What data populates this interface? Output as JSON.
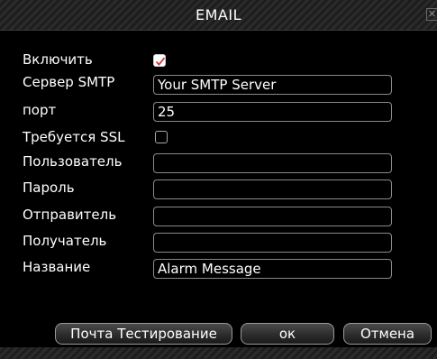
{
  "window": {
    "title": "EMAIL",
    "close_icon": "close-icon"
  },
  "form": {
    "enable": {
      "label": "Включить",
      "checked": true
    },
    "smtp_server": {
      "label": "Сервер SMTP",
      "value": "Your SMTP Server"
    },
    "port": {
      "label": "порт",
      "value": "25"
    },
    "ssl": {
      "label": "Требуется SSL",
      "checked": false
    },
    "user": {
      "label": "Пользователь",
      "value": ""
    },
    "password": {
      "label": "Пароль",
      "value": ""
    },
    "sender": {
      "label": "Отправитель",
      "value": ""
    },
    "receiver": {
      "label": "Получатель",
      "value": ""
    },
    "subject": {
      "label": "Название",
      "value": "Alarm Message"
    }
  },
  "buttons": {
    "test": "Почта Тестирование",
    "ok": "ок",
    "cancel": "Отмена"
  },
  "colors": {
    "check_mark": "#d0343a",
    "background": "#000000",
    "border": "#8a8a8a"
  }
}
